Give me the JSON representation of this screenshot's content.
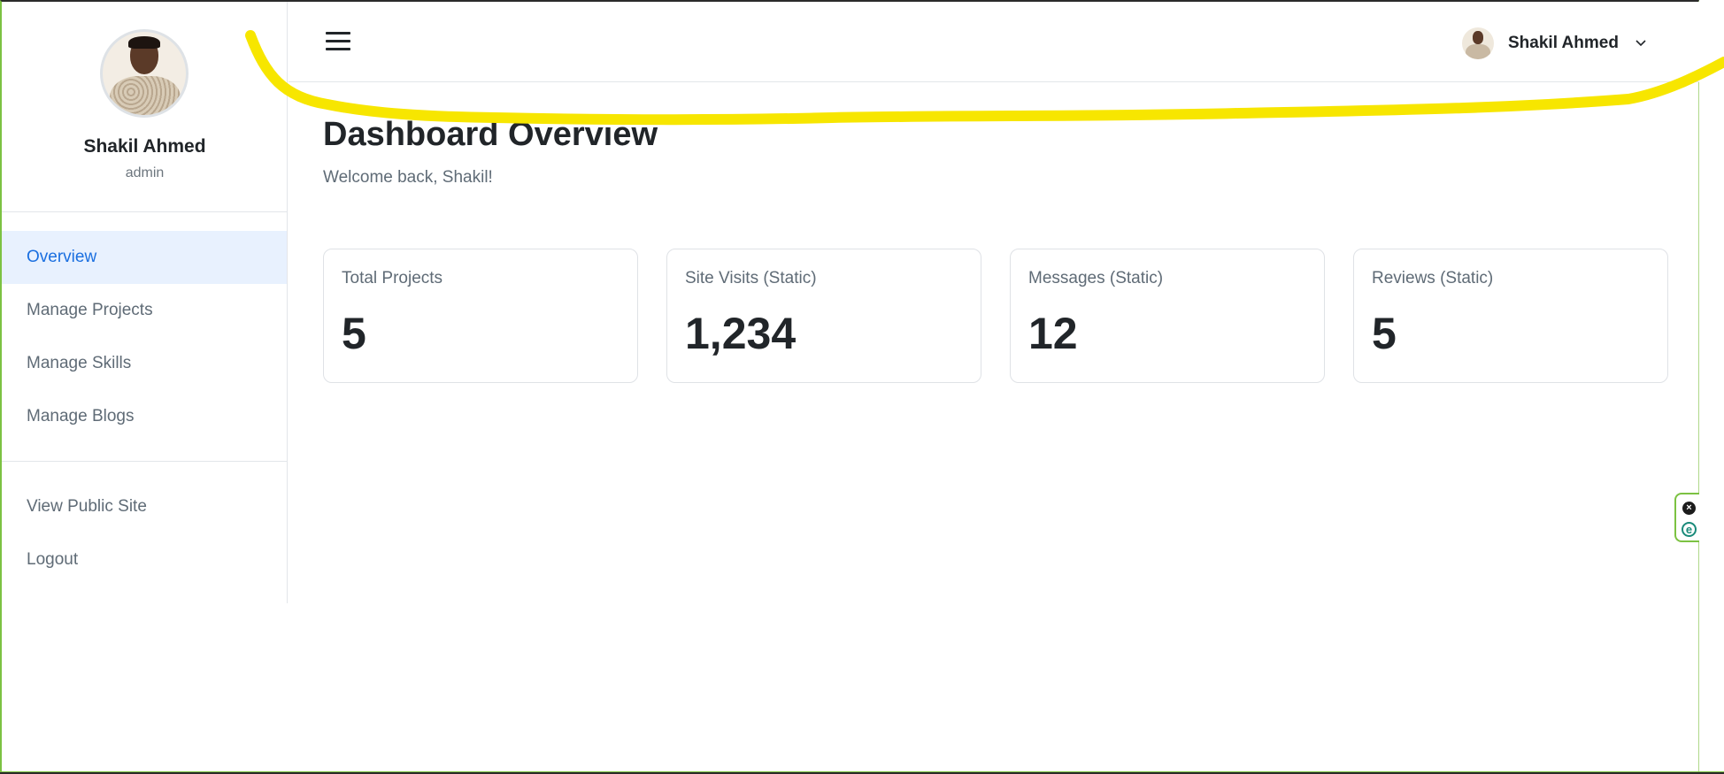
{
  "sidebar": {
    "profile_name": "Shakil Ahmed",
    "profile_role": "admin",
    "nav_items": [
      {
        "label": "Overview",
        "active": true
      },
      {
        "label": "Manage Projects",
        "active": false
      },
      {
        "label": "Manage Skills",
        "active": false
      },
      {
        "label": "Manage Blogs",
        "active": false
      }
    ],
    "secondary_items": [
      {
        "label": "View Public Site"
      },
      {
        "label": "Logout"
      }
    ]
  },
  "topbar": {
    "menu_icon": "hamburger-menu-icon",
    "user_name": "Shakil Ahmed",
    "dropdown_icon": "chevron-down-icon"
  },
  "main": {
    "title": "Dashboard Overview",
    "subtitle": "Welcome back, Shakil!",
    "stats": [
      {
        "label": "Total Projects",
        "value": "5"
      },
      {
        "label": "Site Visits (Static)",
        "value": "1,234"
      },
      {
        "label": "Messages (Static)",
        "value": "12"
      },
      {
        "label": "Reviews (Static)",
        "value": "5"
      }
    ]
  },
  "extension": {
    "close_icon": "close-circle-icon",
    "logo_icon": "extension-e-icon",
    "logo_glyph": "e"
  },
  "colors": {
    "accent": "#1a6fe0",
    "active_bg": "#e8f1fe",
    "scribble": "#f7e600",
    "frame": "#7cc242"
  }
}
